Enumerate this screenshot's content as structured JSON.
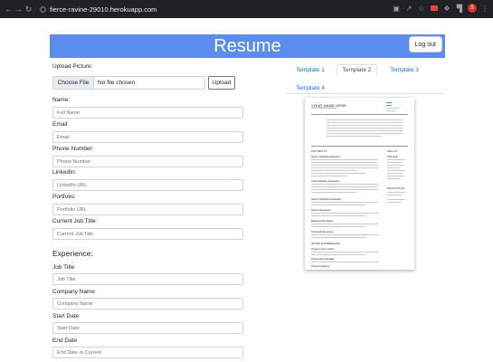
{
  "browser": {
    "url": "fierce-ravine-29010.herokuapp.com",
    "profile_initial": "S"
  },
  "header": {
    "title": "Resume",
    "logout_label": "Log out"
  },
  "upload": {
    "label": "Upload Picture:",
    "choose_label": "Choose File",
    "file_status": "No file chosen",
    "upload_label": "Upload"
  },
  "fields": [
    {
      "label": "Name:",
      "placeholder": "Full Name"
    },
    {
      "label": "Email:",
      "placeholder": "Email"
    },
    {
      "label": "Phone Number:",
      "placeholder": "Phone Number"
    },
    {
      "label": "LinkedIn:",
      "placeholder": "LinkedIn URL"
    },
    {
      "label": "Portfolio:",
      "placeholder": "Portfolio URL"
    },
    {
      "label": "Current Job Title:",
      "placeholder": "Current Job Title"
    }
  ],
  "experience": {
    "heading": "Experience:",
    "fields": [
      {
        "label": "Job Title",
        "placeholder": "Job Title"
      },
      {
        "label": "Company Name",
        "placeholder": "Company Name"
      },
      {
        "label": "Start Date",
        "placeholder": "Start Date"
      },
      {
        "label": "End Date",
        "placeholder": "End Date or Current"
      }
    ]
  },
  "templates": {
    "tabs": [
      "Template 1",
      "Template 2",
      "Template 3",
      "Template 4"
    ],
    "active_index": 1
  },
  "preview": {
    "name": "YOUR NAME HERE",
    "role": "Senior Software Engineer",
    "sections": {
      "projects": "PROJECTS",
      "work": "WORK EXPERIENCE",
      "skills": "SKILLS",
      "education": "EDUCATION"
    },
    "project_titles": [
      "Senior Software Engineer",
      "Lead Software Developer",
      "Senior Software Developer",
      "Senior Developer",
      "Backend Developer",
      "Frontend Developer"
    ],
    "work_titles": [
      "Project Lorem Ipsum",
      "Project Sed Fringilla",
      "Project Nequent"
    ],
    "skills_title": "Technical"
  },
  "colors": {
    "banner": "#5b8def",
    "link": "#0d6efd"
  }
}
